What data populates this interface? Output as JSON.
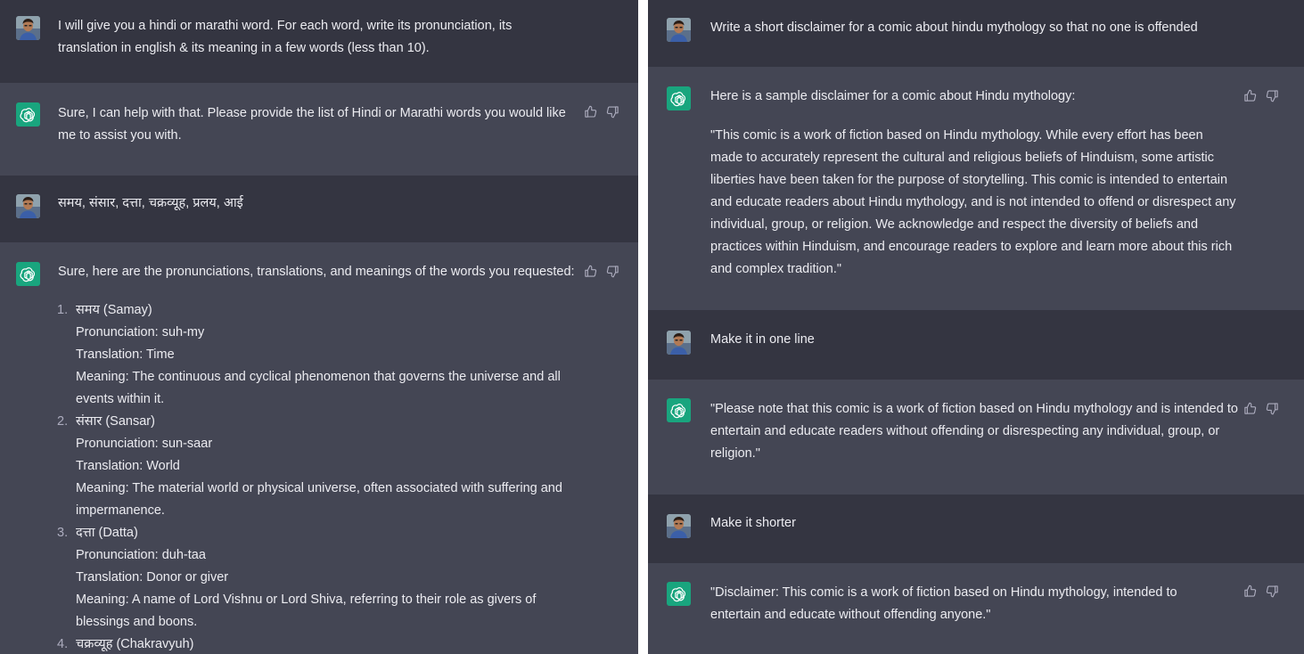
{
  "left": {
    "messages": [
      {
        "role": "user",
        "text": "I will give you a hindi or marathi word. For each word, write its pronunciation, its translation in english & its meaning in a few words (less than 10)."
      },
      {
        "role": "assistant",
        "text": "Sure, I can help with that. Please provide the list of Hindi or Marathi words you would like me to assist you with."
      },
      {
        "role": "user",
        "text": "समय, संसार, दत्ता, चक्रव्यूह, प्रलय, आई"
      },
      {
        "role": "assistant",
        "intro": "Sure, here are the pronunciations, translations, and meanings of the words you requested:",
        "items": [
          {
            "num": "1.",
            "word": "समय (Samay)",
            "pron": "Pronunciation: suh-my",
            "trans": "Translation: Time",
            "meaning": "Meaning: The continuous and cyclical phenomenon that governs the universe and all events within it."
          },
          {
            "num": "2.",
            "word": "संसार (Sansar)",
            "pron": "Pronunciation: sun-saar",
            "trans": "Translation: World",
            "meaning": "Meaning: The material world or physical universe, often associated with suffering and impermanence."
          },
          {
            "num": "3.",
            "word": "दत्ता (Datta)",
            "pron": "Pronunciation: duh-taa",
            "trans": "Translation: Donor or giver",
            "meaning": "Meaning: A name of Lord Vishnu or Lord Shiva, referring to their role as givers of blessings and boons."
          },
          {
            "num": "4.",
            "word": "चक्रव्यूह (Chakravyuh)"
          }
        ]
      }
    ]
  },
  "right": {
    "messages": [
      {
        "role": "user",
        "text": "Write a short disclaimer for a comic about hindu mythology so that no one is offended"
      },
      {
        "role": "assistant",
        "intro": "Here is a sample disclaimer for a comic about Hindu mythology:",
        "body": "\"This comic is a work of fiction based on Hindu mythology. While every effort has been made to accurately represent the cultural and religious beliefs of Hinduism, some artistic liberties have been taken for the purpose of storytelling. This comic is intended to entertain and educate readers about Hindu mythology, and is not intended to offend or disrespect any individual, group, or religion. We acknowledge and respect the diversity of beliefs and practices within Hinduism, and encourage readers to explore and learn more about this rich and complex tradition.\""
      },
      {
        "role": "user",
        "text": "Make it in one line"
      },
      {
        "role": "assistant",
        "text": "\"Please note that this comic is a work of fiction based on Hindu mythology and is intended to entertain and educate readers without offending or disrespecting any individual, group, or religion.\""
      },
      {
        "role": "user",
        "text": "Make it shorter"
      },
      {
        "role": "assistant",
        "text": "\"Disclaimer: This comic is a work of fiction based on Hindu mythology, intended to entertain and educate without offending anyone.\""
      }
    ]
  },
  "colors": {
    "user_bg": "#343541",
    "assistant_bg": "#444654",
    "logo_bg": "#19a57e",
    "text": "#ececf1",
    "icon": "#acacbe"
  },
  "icons": {
    "feedback_up": "thumbs-up-icon",
    "feedback_down": "thumbs-down-icon",
    "assistant_avatar": "openai-logo-icon",
    "user_avatar": "user-avatar-photo"
  }
}
